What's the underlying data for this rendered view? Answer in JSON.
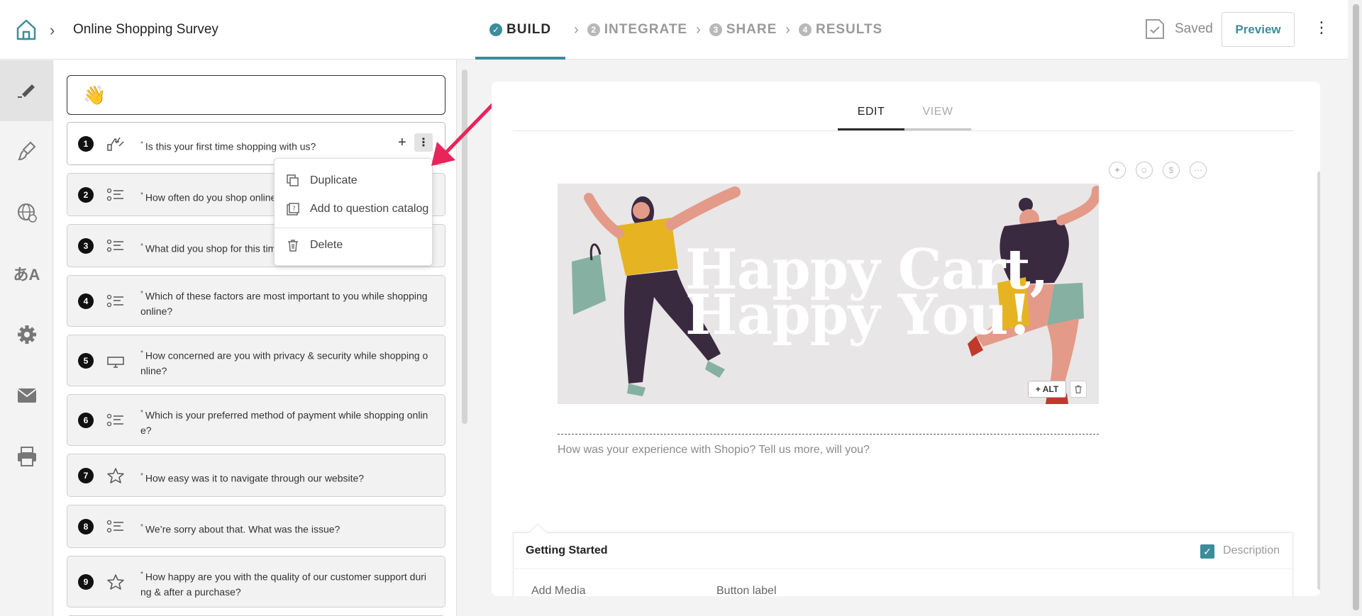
{
  "header": {
    "survey_title": "Online Shopping Survey",
    "steps": [
      {
        "num": "✓",
        "label": "BUILD"
      },
      {
        "num": "2",
        "label": "INTEGRATE"
      },
      {
        "num": "3",
        "label": "SHARE"
      },
      {
        "num": "4",
        "label": "RESULTS"
      }
    ],
    "saved_label": "Saved",
    "preview_label": "Preview"
  },
  "sidebar": {
    "items": [
      {
        "icon": "pen-icon"
      },
      {
        "icon": "paint-brush-icon"
      },
      {
        "icon": "globe-icon"
      },
      {
        "icon": "translate-icon"
      },
      {
        "icon": "gear-icon"
      },
      {
        "icon": "mail-icon"
      },
      {
        "icon": "print-icon"
      }
    ]
  },
  "welcome": {
    "icon": "👋"
  },
  "questions": [
    {
      "num": "1",
      "icon": "thumbs-icon",
      "text": "Is this your first time shopping with us?"
    },
    {
      "num": "2",
      "icon": "list-icon",
      "text": "How often do you shop online"
    },
    {
      "num": "3",
      "icon": "list-icon",
      "text": "What did you shop for this tim"
    },
    {
      "num": "4",
      "icon": "list-icon",
      "text": "Which of these factors are most important to you while shopping online?"
    },
    {
      "num": "5",
      "icon": "monitor-icon",
      "text": "How concerned are you with privacy & security while shopping o nline?"
    },
    {
      "num": "6",
      "icon": "list-icon",
      "text": "Which is your preferred method of payment while shopping onlin e?"
    },
    {
      "num": "7",
      "icon": "star-icon",
      "text": "How easy was it to navigate through our website?"
    },
    {
      "num": "8",
      "icon": "list-icon",
      "text": "We’re sorry about that. What was the issue?"
    },
    {
      "num": "9",
      "icon": "star-icon",
      "text": "How happy are you with the quality of our customer support duri ng & after a purchase?"
    }
  ],
  "context_menu": {
    "duplicate": "Duplicate",
    "add_catalog": "Add to question catalog",
    "delete": "Delete"
  },
  "editor": {
    "tabs": [
      "EDIT",
      "VIEW"
    ],
    "banner_line1": "Happy Cart,",
    "banner_line2": "Happy You!",
    "alt_label": "+ ALT",
    "description": "How was your experience with Shopio? Tell us more, will you?"
  },
  "getting_started": {
    "title": "Getting Started",
    "description_label": "Description",
    "add_media": "Add Media",
    "button_label": "Button label"
  },
  "colors": {
    "accent": "#3d8c9a",
    "annotation_arrow": "#e8245a"
  }
}
